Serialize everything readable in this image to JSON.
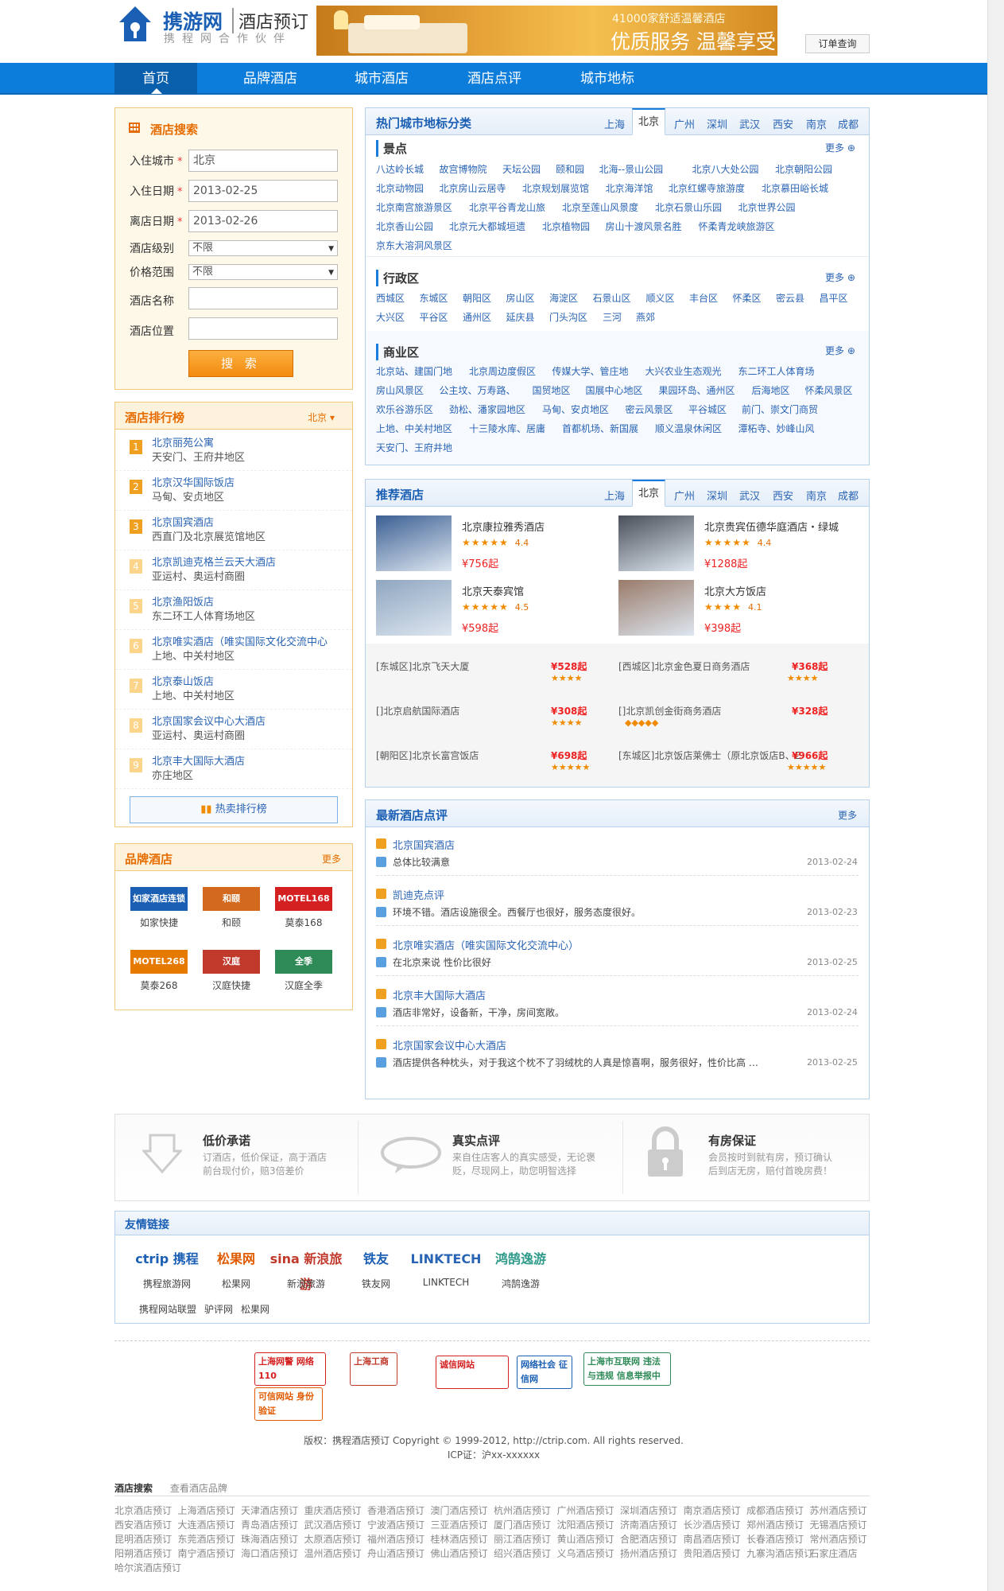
{
  "header": {
    "logo_main": "携游网",
    "logo_sub": "酒店预订",
    "logo_tagline": "携程网合作伙伴",
    "banner_line1": "41000家舒适温馨酒店",
    "banner_line2": "优质服务 温馨享受",
    "order_query": "订单查询"
  },
  "nav": {
    "items": [
      "首页",
      "品牌酒店",
      "城市酒店",
      "酒店点评",
      "城市地标"
    ]
  },
  "search": {
    "title": "酒店搜索",
    "city_label": "入住城市",
    "city_value": "北京",
    "checkin_label": "入住日期",
    "checkin_value": "2013-02-25",
    "checkout_label": "离店日期",
    "checkout_value": "2013-02-26",
    "level_label": "酒店级别",
    "level_value": "不限",
    "price_label": "价格范围",
    "price_value": "不限",
    "name_label": "酒店名称",
    "name_value": "",
    "location_label": "酒店位置",
    "location_value": "",
    "button": "搜 索"
  },
  "rank": {
    "title": "酒店排行榜",
    "city": "北京",
    "items": [
      {
        "n": "1",
        "name": "北京丽苑公寓",
        "area": "天安门、王府井地区"
      },
      {
        "n": "2",
        "name": "北京汉华国际饭店",
        "area": "马甸、安贞地区"
      },
      {
        "n": "3",
        "name": "北京国宾酒店",
        "area": "西直门及北京展览馆地区"
      },
      {
        "n": "4",
        "name": "北京凯迪克格兰云天大酒店",
        "area": "亚运村、奥运村商圈"
      },
      {
        "n": "5",
        "name": "北京渔阳饭店",
        "area": "东二环工人体育场地区"
      },
      {
        "n": "6",
        "name": "北京唯实酒店（唯实国际文化交流中心",
        "area": "上地、中关村地区"
      },
      {
        "n": "7",
        "name": "北京泰山饭店",
        "area": "上地、中关村地区"
      },
      {
        "n": "8",
        "name": "北京国家会议中心大酒店",
        "area": "亚运村、奥运村商圈"
      },
      {
        "n": "9",
        "name": "北京丰大国际大酒店",
        "area": "亦庄地区"
      }
    ],
    "hotsale": "热卖排行榜"
  },
  "brand": {
    "title": "品牌酒店",
    "more": "更多",
    "items": [
      {
        "name": "如家快捷",
        "logo": "如家酒店连锁",
        "color": "#1a5fb4"
      },
      {
        "name": "和颐",
        "logo": "和颐",
        "color": "#d2691e"
      },
      {
        "name": "莫泰168",
        "logo": "MOTEL168",
        "color": "#d42020"
      },
      {
        "name": "莫泰268",
        "logo": "MOTEL268",
        "color": "#e67a00"
      },
      {
        "name": "汉庭快捷",
        "logo": "汉庭",
        "color": "#c0392b"
      },
      {
        "name": "汉庭全季",
        "logo": "全季",
        "color": "#2e8b57"
      }
    ]
  },
  "landmark": {
    "title": "热门城市地标分类",
    "tabs": [
      "上海",
      "北京",
      "广州",
      "深圳",
      "武汉",
      "西安",
      "南京",
      "成都"
    ],
    "selected_tab": "北京",
    "more": "更多",
    "scenic": {
      "title": "景点",
      "rows": [
        [
          "八达岭长城",
          "故宫博物院",
          "天坛公园",
          "颐和园",
          "北海--景山公园",
          "北京八大处公园",
          "北京朝阳公园"
        ],
        [
          "北京动物园",
          "北京房山云居寺",
          "北京规划展览馆",
          "北京海洋馆",
          "北京红螺寺旅游度",
          "北京慕田峪长城"
        ],
        [
          "北京南宫旅游景区",
          "北京平谷青龙山旅",
          "北京至莲山风景度",
          "北京石景山乐园",
          "北京世界公园"
        ],
        [
          "北京香山公园",
          "北京元大都城垣遗",
          "北京植物园",
          "房山十渡风景名胜",
          "怀柔青龙峡旅游区"
        ],
        [
          "京东大溶洞风景区"
        ]
      ]
    },
    "district": {
      "title": "行政区",
      "rows": [
        [
          "西城区",
          "东城区",
          "朝阳区",
          "房山区",
          "海淀区",
          "石景山区",
          "顺义区",
          "丰台区",
          "怀柔区",
          "密云县",
          "昌平区"
        ],
        [
          "大兴区",
          "平谷区",
          "通州区",
          "延庆县",
          "门头沟区",
          "三河",
          "燕郊"
        ]
      ]
    },
    "business": {
      "title": "商业区",
      "rows": [
        [
          "北京站、建国门地",
          "北京周边度假区",
          "传媒大学、管庄地",
          "大兴农业生态观光",
          "东二环工人体育场"
        ],
        [
          "房山风景区",
          "公主坟、万寿路、",
          "国贸地区",
          "国展中心地区",
          "果园环岛、通州区",
          "后海地区",
          "怀柔风景区"
        ],
        [
          "欢乐谷游乐区",
          "劲松、潘家园地区",
          "马甸、安贞地区",
          "密云风景区",
          "平谷城区",
          "前门、崇文门商贸"
        ],
        [
          "上地、中关村地区",
          "十三陵水库、居庸",
          "首都机场、新国展",
          "顺义温泉休闲区",
          "潭柘寺、妙峰山风"
        ],
        [
          "天安门、王府井地"
        ]
      ]
    }
  },
  "recommend": {
    "title": "推荐酒店",
    "tabs": [
      "上海",
      "北京",
      "广州",
      "深圳",
      "武汉",
      "西安",
      "南京",
      "成都"
    ],
    "selected_tab": "北京",
    "featured": [
      {
        "name": "北京康拉雅秀酒店",
        "stars": "★★★★★",
        "score": "4.4",
        "price": "¥756起",
        "img": "#3b5f93"
      },
      {
        "name": "北京贵宾伍德华庭酒店・绿城",
        "stars": "★★★★★",
        "score": "4.4",
        "price": "¥1288起",
        "img": "#4a4f5a"
      },
      {
        "name": "北京天泰宾馆",
        "stars": "★★★★★",
        "score": "4.5",
        "price": "¥598起",
        "img": "#8fa6c0"
      },
      {
        "name": "北京大方饭店",
        "stars": "★★★★",
        "score": "4.1",
        "price": "¥398起",
        "img": "#9a7b6a"
      }
    ],
    "list": [
      {
        "name": "[东城区]北京飞天大厦",
        "price": "¥528起",
        "stars": "★★★★"
      },
      {
        "name": "[西城区]北京金色夏日商务酒店",
        "price": "¥368起",
        "stars": "★★★★"
      },
      {
        "name": "[]北京启航国际酒店",
        "price": "¥308起",
        "stars": "★★★★"
      },
      {
        "name": "[]北京凯创金街商务酒店",
        "price": "¥328起",
        "stars": "◆◆◆◆◆"
      },
      {
        "name": "[朝阳区]北京长富宫饭店",
        "price": "¥698起",
        "stars": "★★★★★"
      },
      {
        "name": "[东城区]北京饭店莱佛士（原北京饭店B、E座",
        "price": "¥966起",
        "stars": "★★★★★"
      }
    ]
  },
  "reviews": {
    "title": "最新酒店点评",
    "more": "更多",
    "items": [
      {
        "hotel": "北京国宾酒店",
        "text": "总体比较满意",
        "date": "2013-02-24"
      },
      {
        "hotel": "凯迪克点评",
        "text": "环境不错。酒店设施很全。西餐厅也很好，服务态度很好。",
        "date": "2013-02-23"
      },
      {
        "hotel": "北京唯实酒店（唯实国际文化交流中心）",
        "text": "在北京来说 性价比很好",
        "date": "2013-02-25"
      },
      {
        "hotel": "北京丰大国际大酒店",
        "text": "酒店非常好，设备新，干净，房间宽敞。",
        "date": "2013-02-24"
      },
      {
        "hotel": "北京国家会议中心大酒店",
        "text": "酒店提供各种枕头，对于我这个枕不了羽绒枕的人真是惊喜啊，服务很好，性价比高 …",
        "date": "2013-02-25"
      }
    ]
  },
  "features": [
    {
      "title": "低价承诺",
      "text": [
        "订酒店，低价保证，高于酒店",
        "前台现付价，赔3倍差价"
      ]
    },
    {
      "title": "真实点评",
      "text": [
        "来自住店客人的真实感受，无论褒",
        "贬，尽现网上，助您明智选择"
      ]
    },
    {
      "title": "有房保证",
      "text": [
        "会员按时到就有房，预订确认",
        "后到店无房，赔付首晚房费！"
      ]
    }
  ],
  "friends": {
    "title": "友情链接",
    "items": [
      {
        "logo": "ctrip 携程",
        "name": "携程旅游网",
        "color": "#1a5fb4"
      },
      {
        "logo": "松果网",
        "name": "松果网",
        "color": "#e05a00"
      },
      {
        "logo": "sina 新浪旅游",
        "name": "新浪旅游",
        "color": "#c0392b"
      },
      {
        "logo": "铁友",
        "name": "铁友网",
        "color": "#1a5fb4"
      },
      {
        "logo": "LINKTECH",
        "name": "LINKTECH",
        "color": "#2a64b4"
      },
      {
        "logo": "鸿鹄逸游",
        "name": "鸿鹄逸游",
        "color": "#2e9a8a"
      }
    ],
    "text_links": [
      "携程网站联盟",
      "驴评网",
      "松果网"
    ]
  },
  "footer": {
    "badges": [
      {
        "text": "上海网警 网络110",
        "color": "#d42020"
      },
      {
        "text": "上海工商",
        "color": "#c0392b"
      },
      {
        "text": "诚信网站",
        "color": "#d42020"
      },
      {
        "text": "网络社会 征信网",
        "color": "#1a5fb4"
      },
      {
        "text": "上海市互联网 违法与违规 信息举报中心",
        "color": "#2e8b57"
      },
      {
        "text": "可信网站 身份验证",
        "color": "#e05a00"
      }
    ],
    "copyright": "版权：携程酒店预订 Copyright © 1999-2012, http://ctrip.com. All rights reserved.",
    "icp": "ICP证：沪xx-xxxxxx",
    "tab_search": "酒店搜索",
    "tab_brand": "查看酒店品牌",
    "city_rows": [
      [
        "北京酒店预订",
        "上海酒店预订",
        "天津酒店预订",
        "重庆酒店预订",
        "香港酒店预订",
        "澳门酒店预订",
        "杭州酒店预订",
        "广州酒店预订",
        "深圳酒店预订",
        "南京酒店预订",
        "成都酒店预订",
        "苏州酒店预订"
      ],
      [
        "西安酒店预订",
        "大连酒店预订",
        "青岛酒店预订",
        "武汉酒店预订",
        "宁波酒店预订",
        "三亚酒店预订",
        "厦门酒店预订",
        "沈阳酒店预订",
        "济南酒店预订",
        "长沙酒店预订",
        "郑州酒店预订",
        "无锡酒店预订"
      ],
      [
        "昆明酒店预订",
        "东莞酒店预订",
        "珠海酒店预订",
        "太原酒店预订",
        "福州酒店预订",
        "桂林酒店预订",
        "丽江酒店预订",
        "黄山酒店预订",
        "合肥酒店预订",
        "南昌酒店预订",
        "长春酒店预订",
        "常州酒店预订"
      ],
      [
        "阳朔酒店预订",
        "南宁酒店预订",
        "海口酒店预订",
        "温州酒店预订",
        "舟山酒店预订",
        "佛山酒店预订",
        "绍兴酒店预订",
        "义乌酒店预订",
        "扬州酒店预订",
        "贵阳酒店预订",
        "九寨沟酒店预订",
        "石家庄酒店"
      ],
      [
        "哈尔滨酒店预订"
      ]
    ]
  },
  "colors": {
    "primary": "#0d7ddb",
    "accent": "#f38a10",
    "link": "#2a64b4"
  }
}
